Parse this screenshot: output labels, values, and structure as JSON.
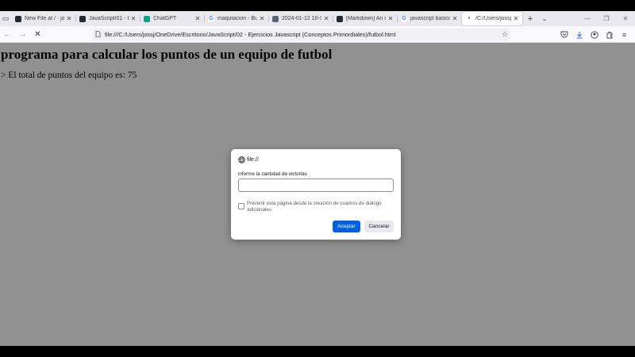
{
  "tabs": [
    {
      "title": "New File at / · joss",
      "icon": "github-icon"
    },
    {
      "title": "JavaScript/01 - Ba",
      "icon": "github-icon"
    },
    {
      "title": "ChatGPT",
      "icon": "chatgpt-icon"
    },
    {
      "title": "maqutacion - Bus",
      "icon": "google-icon"
    },
    {
      "title": "2024-01-12 10-32",
      "icon": "image-icon"
    },
    {
      "title": "[Markdown] An o",
      "icon": "github-icon"
    },
    {
      "title": "javascript basico",
      "icon": "google-icon"
    },
    {
      "title": "/C:/Users/jossj/On",
      "icon": "loading-dot-icon",
      "active": true
    }
  ],
  "navbar": {
    "url": "file:///C:/Users/jossj/OneDrive/Escritorio/JavaScript/02 - Ejercicios Javascript (Conceptos Primordiales)/futbol.html"
  },
  "page": {
    "heading": "programa para calcular los puntos de un equipo de futbol",
    "result": "> El total de puntos del equipo es: 75"
  },
  "dialog": {
    "origin": "file://",
    "message": "informe la cantidad de victorias",
    "input_value": "",
    "checkbox_label": "Prevenir esta página desde la creación de cuadros de diálogo adicionales",
    "accept_label": "Aceptar",
    "cancel_label": "Cancelar",
    "accent_color": "#0061e0"
  }
}
